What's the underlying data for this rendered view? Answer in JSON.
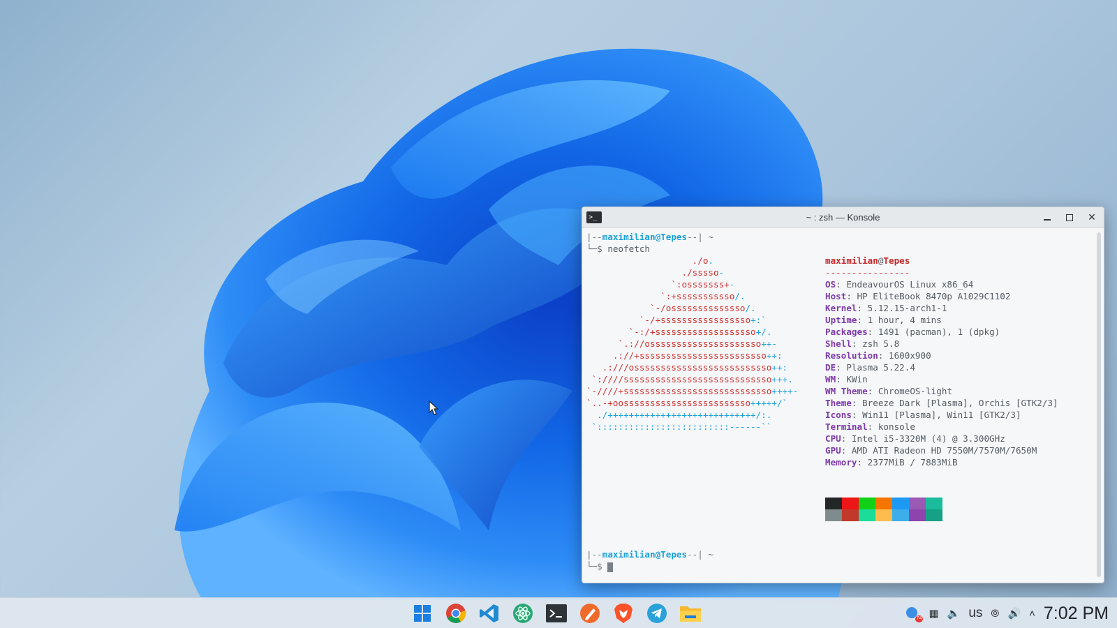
{
  "window": {
    "title": "~ : zsh — Konsole",
    "app_icon_label": ">_",
    "minimize": "—",
    "maximize": "☐",
    "close": "✕"
  },
  "terminal": {
    "prompt_user": "maximilian@Tepes",
    "prompt_prefix": "|--",
    "prompt_suffix": "--| ~",
    "prompt_cmd_prefix": "└─$ ",
    "command": "neofetch",
    "ascii_art": [
      {
        "red": "./o",
        "cyan": "."
      },
      {
        "red": "./sssso",
        "cyan": "-"
      },
      {
        "red": "`:osssssss+",
        "cyan": "-"
      },
      {
        "red": "`:+sssssssssso",
        "cyan": "/."
      },
      {
        "red": "`-/ossssssssssssso",
        "cyan": "/."
      },
      {
        "red": "`-/+sssssssssssssssso",
        "cyan": "+:`"
      },
      {
        "red": "`-:/+sssssssssssssssssso",
        "cyan": "+/."
      },
      {
        "red": "`.://osssssssssssssssssssso",
        "cyan": "++-"
      },
      {
        "red": ".://+ssssssssssssssssssssssso",
        "cyan": "++:"
      },
      {
        "red": ".:///ossssssssssssssssssssssssso",
        "cyan": "++:"
      },
      {
        "red": "`:////ssssssssssssssssssssssssssso",
        "cyan": "+++."
      },
      {
        "red": "`-////+ssssssssssssssssssssssssssso",
        "cyan": "++++-"
      },
      {
        "red": "`..-+oossssssssssssssssssssssso",
        "cyan": "+++++/`"
      },
      {
        "red": "",
        "cyan": "./++++++++++++++++++++++++++++/:."
      },
      {
        "red": "",
        "cyan": "`:::::::::::::::::::::::::------``"
      }
    ],
    "ascii_indent": [
      20,
      18,
      16,
      14,
      12,
      10,
      8,
      6,
      5,
      3,
      1,
      0,
      0,
      2,
      1
    ],
    "info_user": "maximilian",
    "info_at": "@",
    "info_host": "Tepes",
    "info_rule": "----------------",
    "info": [
      {
        "key": "OS",
        "value": "EndeavourOS Linux x86_64"
      },
      {
        "key": "Host",
        "value": "HP EliteBook 8470p A1029C1102"
      },
      {
        "key": "Kernel",
        "value": "5.12.15-arch1-1"
      },
      {
        "key": "Uptime",
        "value": "1 hour, 4 mins"
      },
      {
        "key": "Packages",
        "value": "1491 (pacman), 1 (dpkg)"
      },
      {
        "key": "Shell",
        "value": "zsh 5.8"
      },
      {
        "key": "Resolution",
        "value": "1600x900"
      },
      {
        "key": "DE",
        "value": "Plasma 5.22.4"
      },
      {
        "key": "WM",
        "value": "KWin"
      },
      {
        "key": "WM Theme",
        "value": "ChromeOS-light"
      },
      {
        "key": "Theme",
        "value": "Breeze Dark [Plasma], Orchis [GTK2/3]"
      },
      {
        "key": "Icons",
        "value": "Win11 [Plasma], Win11 [GTK2/3]"
      },
      {
        "key": "Terminal",
        "value": "konsole"
      },
      {
        "key": "CPU",
        "value": "Intel i5-3320M (4) @ 3.300GHz"
      },
      {
        "key": "GPU",
        "value": "AMD ATI Radeon HD 7550M/7570M/7650M"
      },
      {
        "key": "Memory",
        "value": "2377MiB / 7883MiB"
      }
    ],
    "swatches": [
      "#232627",
      "#ed1515",
      "#11d116",
      "#f67400",
      "#1d99f3",
      "#9b59b6",
      "#1abc9c",
      "#7f8c8d",
      "#c0392b",
      "#1cdc9a",
      "#fdbc4b",
      "#3daee9",
      "#8e44ad",
      "#16a085"
    ]
  },
  "taskbar": {
    "apps": [
      {
        "name": "start-menu-button",
        "icon": "windows-logo-icon"
      },
      {
        "name": "chrome-button",
        "icon": "chrome-icon"
      },
      {
        "name": "vscode-button",
        "icon": "vscode-icon"
      },
      {
        "name": "atom-button",
        "icon": "atom-icon"
      },
      {
        "name": "konsole-button",
        "icon": "terminal-icon"
      },
      {
        "name": "pen-app-button",
        "icon": "pen-icon"
      },
      {
        "name": "brave-button",
        "icon": "brave-icon"
      },
      {
        "name": "telegram-button",
        "icon": "telegram-icon"
      },
      {
        "name": "files-button",
        "icon": "folder-icon"
      }
    ],
    "tray": {
      "keyboard_layout": "us",
      "clock": "7:02 PM",
      "badge": "74"
    }
  }
}
